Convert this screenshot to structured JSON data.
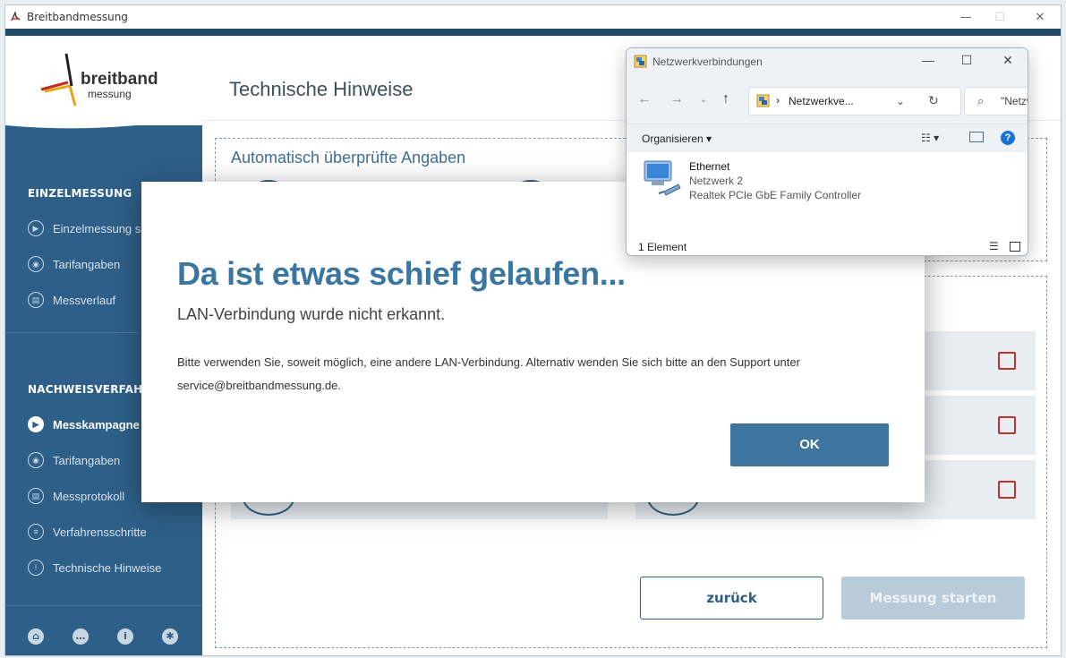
{
  "app": {
    "title": "Breitbandmessung",
    "window_controls": {
      "minimize": "—",
      "maximize": "☐",
      "close": "✕"
    }
  },
  "logo": {
    "line1": "breitband",
    "line2": "messung"
  },
  "sidebar": {
    "section1_heading": "EINZELMESSUNG",
    "section1_items": [
      {
        "label": "Einzelmessung s",
        "icon": "play-circle-icon"
      },
      {
        "label": "Tarifangaben",
        "icon": "user-circle-icon"
      },
      {
        "label": "Messverlauf",
        "icon": "document-circle-icon"
      }
    ],
    "section2_heading": "NACHWEISVERFAHRE",
    "section2_items": [
      {
        "label": "Messkampagne s",
        "icon": "play-circle-icon",
        "active": true
      },
      {
        "label": "Tarifangaben",
        "icon": "user-circle-icon"
      },
      {
        "label": "Messprotokoll",
        "icon": "document-circle-icon"
      },
      {
        "label": "Verfahrensschritte",
        "icon": "list-circle-icon"
      },
      {
        "label": "Technische Hinweise",
        "icon": "warning-circle-icon"
      }
    ],
    "bottom_icons": [
      "home-icon",
      "chat-icon",
      "info-icon",
      "gear-icon"
    ]
  },
  "main": {
    "page_title": "Technische Hinweise",
    "auto_section_title": "Automatisch überprüfte Angaben",
    "back_button": "zurück",
    "start_button": "Messung starten"
  },
  "dialog": {
    "title": "Da ist etwas schief gelaufen...",
    "subtitle": "LAN-Verbindung wurde nicht erkannt.",
    "body_line1": "Bitte verwenden Sie, soweit möglich, eine andere LAN-Verbindung. Alternativ wenden Sie sich bitte an den Support unter",
    "body_line2": "service@breitbandmessung.de.",
    "ok_button": "OK"
  },
  "network_window": {
    "title": "Netzwerkverbindungen",
    "address": "Netzwerkve...",
    "search_placeholder": "\"Netzw",
    "organize_label": "Organisieren",
    "item": {
      "name": "Ethernet",
      "network": "Netzwerk 2",
      "adapter": "Realtek PCIe GbE Family Controller"
    },
    "status_count": "1 Element"
  },
  "colors": {
    "sidebar": "#2e5f88",
    "accent_bar": "#214a66",
    "dialog_title": "#3b76a1",
    "ok_button": "#3d74a0",
    "error_red": "#c0302b"
  }
}
